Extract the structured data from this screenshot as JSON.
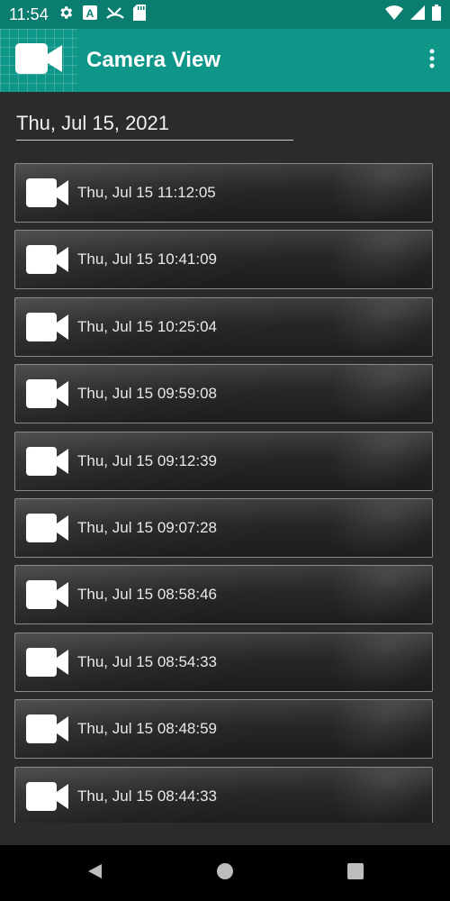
{
  "status_bar": {
    "time": "11:54",
    "left_icons": [
      "gear-icon",
      "text-a-icon",
      "missed-call-icon",
      "sd-card-icon"
    ],
    "right_icons": [
      "wifi-icon",
      "signal-icon",
      "battery-icon"
    ]
  },
  "app_bar": {
    "title": "Camera View",
    "logo_icon": "video-camera-icon",
    "overflow_icon": "more-vert-icon"
  },
  "date_header": "Thu, Jul 15, 2021",
  "recordings": [
    {
      "label": "Thu, Jul 15 11:12:05"
    },
    {
      "label": "Thu, Jul 15 10:41:09"
    },
    {
      "label": "Thu, Jul 15 10:25:04"
    },
    {
      "label": "Thu, Jul 15 09:59:08"
    },
    {
      "label": "Thu, Jul 15 09:12:39"
    },
    {
      "label": "Thu, Jul 15 09:07:28"
    },
    {
      "label": "Thu, Jul 15 08:58:46"
    },
    {
      "label": "Thu, Jul 15 08:54:33"
    },
    {
      "label": "Thu, Jul 15 08:48:59"
    },
    {
      "label": "Thu, Jul 15 08:44:33"
    }
  ],
  "nav_bar": [
    "back-icon",
    "home-icon",
    "recents-icon"
  ],
  "colors": {
    "status_bar": "#0b7d70",
    "app_bar": "#0e9688",
    "background": "#2b2b2b",
    "nav_bar": "#000000"
  }
}
